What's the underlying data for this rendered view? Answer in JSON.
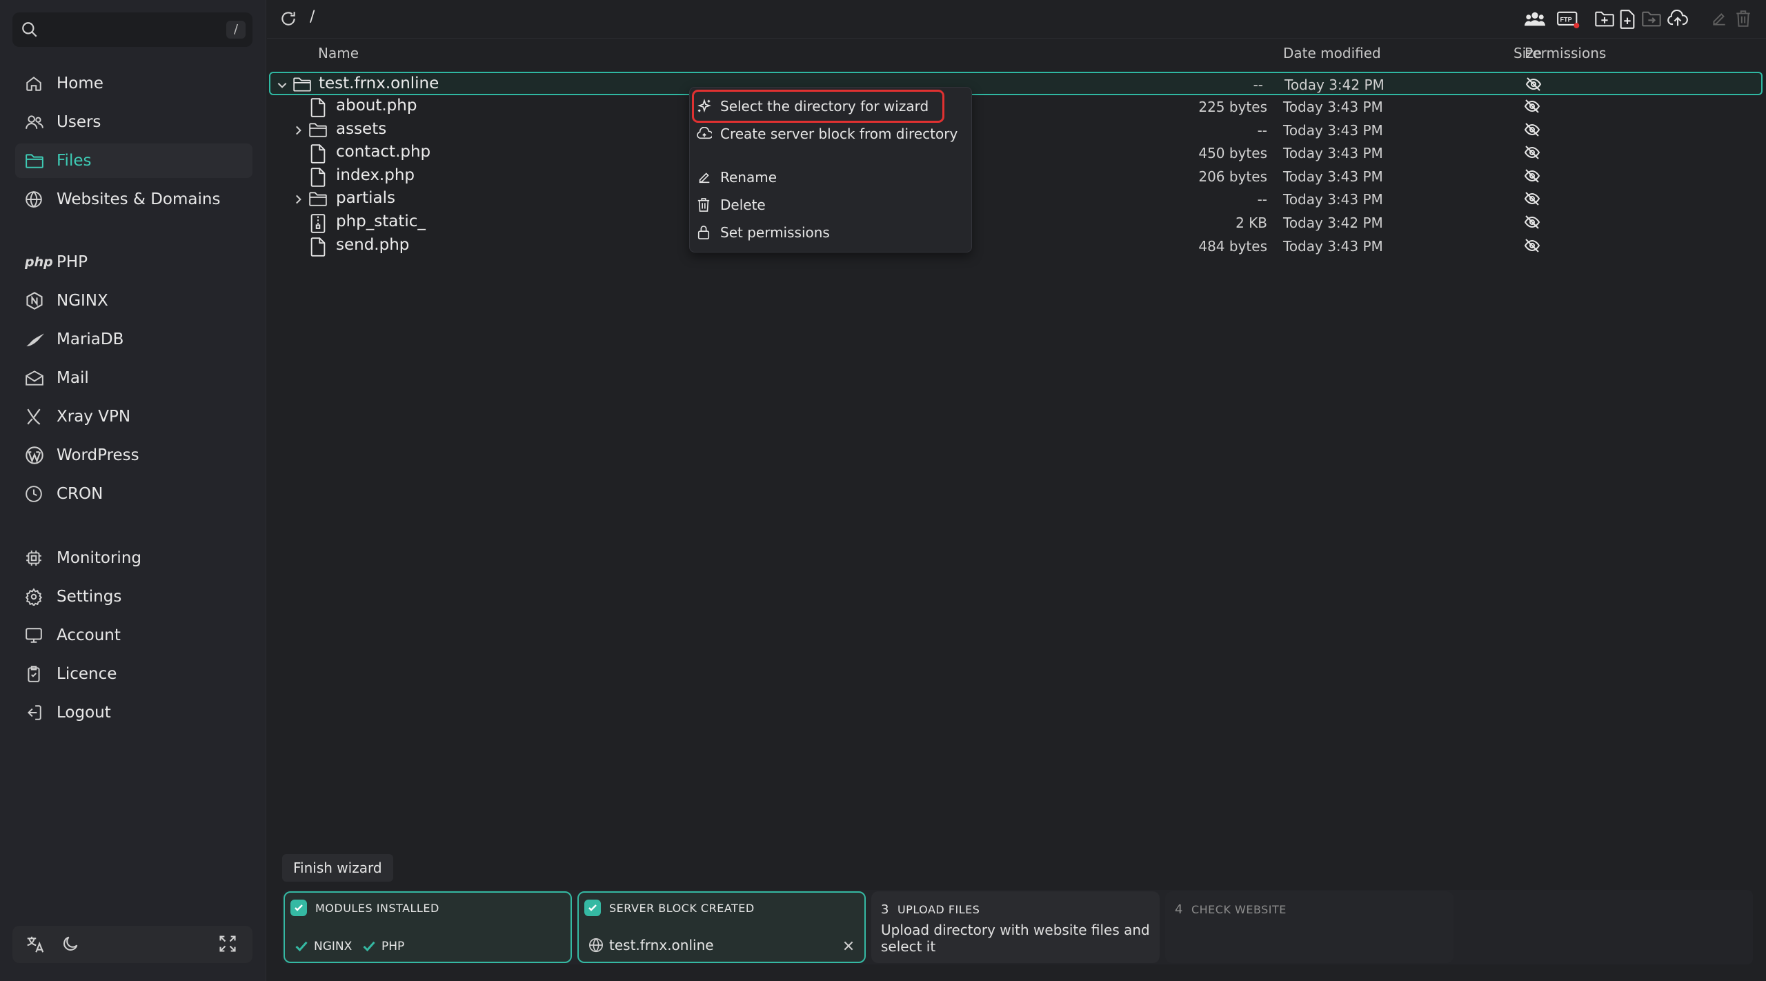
{
  "sidebar": {
    "search_shortcut": "/",
    "nav_main": [
      {
        "label": "Home",
        "icon": "home-icon"
      },
      {
        "label": "Users",
        "icon": "users-icon"
      },
      {
        "label": "Files",
        "icon": "folder-icon",
        "active": true
      },
      {
        "label": "Websites & Domains",
        "icon": "globe-icon"
      }
    ],
    "nav_services": [
      {
        "label": "PHP",
        "icon": "php-icon",
        "icon_text": "php"
      },
      {
        "label": "NGINX",
        "icon": "nginx-icon"
      },
      {
        "label": "MariaDB",
        "icon": "mariadb-icon"
      },
      {
        "label": "Mail",
        "icon": "mail-icon"
      },
      {
        "label": "Xray VPN",
        "icon": "xray-icon"
      },
      {
        "label": "WordPress",
        "icon": "wordpress-icon"
      },
      {
        "label": "CRON",
        "icon": "clock-icon"
      }
    ],
    "nav_system": [
      {
        "label": "Monitoring",
        "icon": "cpu-icon"
      },
      {
        "label": "Settings",
        "icon": "gear-icon"
      },
      {
        "label": "Account",
        "icon": "monitor-icon"
      },
      {
        "label": "Licence",
        "icon": "licence-icon"
      },
      {
        "label": "Logout",
        "icon": "logout-icon"
      }
    ]
  },
  "topbar": {
    "path": "/"
  },
  "columns": {
    "name": "Name",
    "size": "Size",
    "date": "Date modified",
    "permissions": "Permissions"
  },
  "files": [
    {
      "name": "test.frnx.online",
      "type": "folder",
      "expanded": true,
      "size": "--",
      "date": "Today 3:42 PM"
    },
    {
      "name": "about.php",
      "type": "file",
      "size": "225 bytes",
      "date": "Today 3:43 PM"
    },
    {
      "name": "assets",
      "type": "folder",
      "size": "--",
      "date": "Today 3:43 PM"
    },
    {
      "name": "contact.php",
      "type": "file",
      "size": "450 bytes",
      "date": "Today 3:43 PM"
    },
    {
      "name": "index.php",
      "type": "file",
      "size": "206 bytes",
      "date": "Today 3:43 PM"
    },
    {
      "name": "partials",
      "type": "folder",
      "size": "--",
      "date": "Today 3:43 PM"
    },
    {
      "name": "php_static_",
      "type": "archive",
      "size": "2 KB",
      "date": "Today 3:42 PM"
    },
    {
      "name": "send.php",
      "type": "file",
      "size": "484 bytes",
      "date": "Today 3:43 PM"
    }
  ],
  "context_menu": {
    "items": [
      {
        "label": "Select the directory for wizard",
        "icon": "sparkle-icon"
      },
      {
        "label": "Create server block from directory",
        "icon": "cloud-icon"
      },
      {
        "label": "Rename",
        "icon": "edit-icon"
      },
      {
        "label": "Delete",
        "icon": "trash-icon"
      },
      {
        "label": "Set permissions",
        "icon": "lock-icon"
      }
    ]
  },
  "wizard": {
    "finish_label": "Finish wizard",
    "steps": [
      {
        "title": "MODULES INSTALLED",
        "status": "done",
        "modules": [
          "NGINX",
          "PHP"
        ]
      },
      {
        "title": "SERVER BLOCK CREATED",
        "status": "done",
        "value": "test.frnx.online"
      },
      {
        "number": "3",
        "title": "UPLOAD FILES",
        "status": "current",
        "desc": "Upload directory with website files and select it"
      },
      {
        "number": "4",
        "title": "CHECK WEBSITE",
        "status": "pending"
      }
    ]
  },
  "colors": {
    "accent": "#35b9a3",
    "highlight": "#e03131",
    "background": "#202124"
  }
}
